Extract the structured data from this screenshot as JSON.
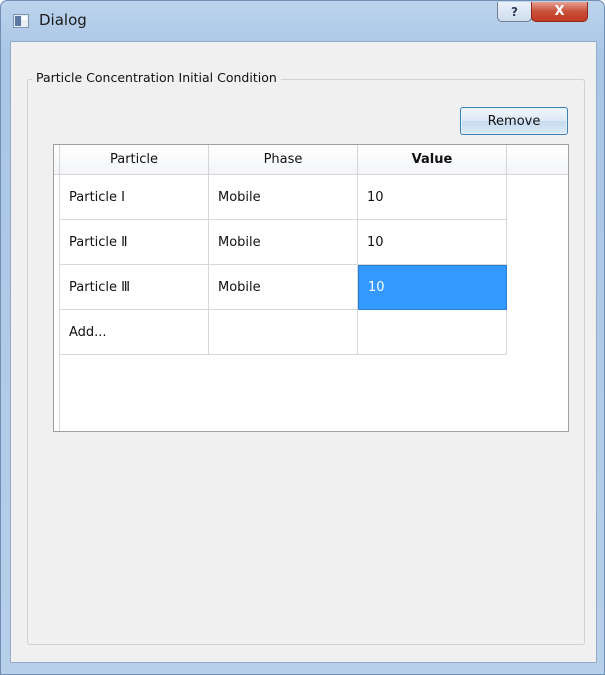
{
  "window": {
    "title": "Dialog",
    "help_glyph": "?",
    "close_glyph": "X"
  },
  "group": {
    "title": "Particle Concentration Initial Condition"
  },
  "toolbar": {
    "remove_label": "Remove"
  },
  "table": {
    "columns": [
      "Particle",
      "Phase",
      "Value"
    ],
    "rows": [
      {
        "particle": "Particle I",
        "phase": "Mobile",
        "value": "10"
      },
      {
        "particle": "Particle Ⅱ",
        "phase": "Mobile",
        "value": "10"
      },
      {
        "particle": "Particle Ⅲ",
        "phase": "Mobile",
        "value": "10"
      },
      {
        "particle": "Add...",
        "phase": "",
        "value": ""
      }
    ],
    "selected_cell": "Particle Ⅲ / Value"
  },
  "colors": {
    "selection": "#3399ff",
    "close_button": "#c8503a"
  }
}
